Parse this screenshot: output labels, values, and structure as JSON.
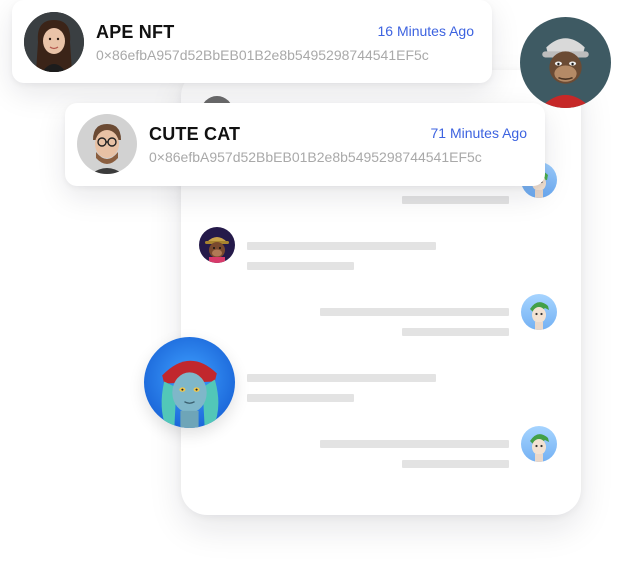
{
  "notifications": [
    {
      "title": "APE NFT",
      "time": "16 Minutes Ago",
      "address": "0×86efbA957d52BbEB01B2e8b5495298744541EF5c",
      "avatar_icon": "woman-avatar-icon"
    },
    {
      "title": "CUTE CAT",
      "time": "71 Minutes Ago",
      "address": "0×86efbA957d52BbEB01B2e8b5495298744541EF5c",
      "avatar_icon": "man-glasses-avatar-icon"
    }
  ],
  "chat": {
    "avatars": [
      "bored-ape-avatar-icon",
      "green-hair-nft-avatar-icon",
      "monkey-hat-avatar-icon",
      "pirate-girl-nft-avatar-icon"
    ]
  },
  "colors": {
    "accent_blue": "#3d63e0",
    "address_gray": "#a9a9a9",
    "placeholder_gray": "#e3e3e3",
    "ape_background": "#3e5a63"
  }
}
